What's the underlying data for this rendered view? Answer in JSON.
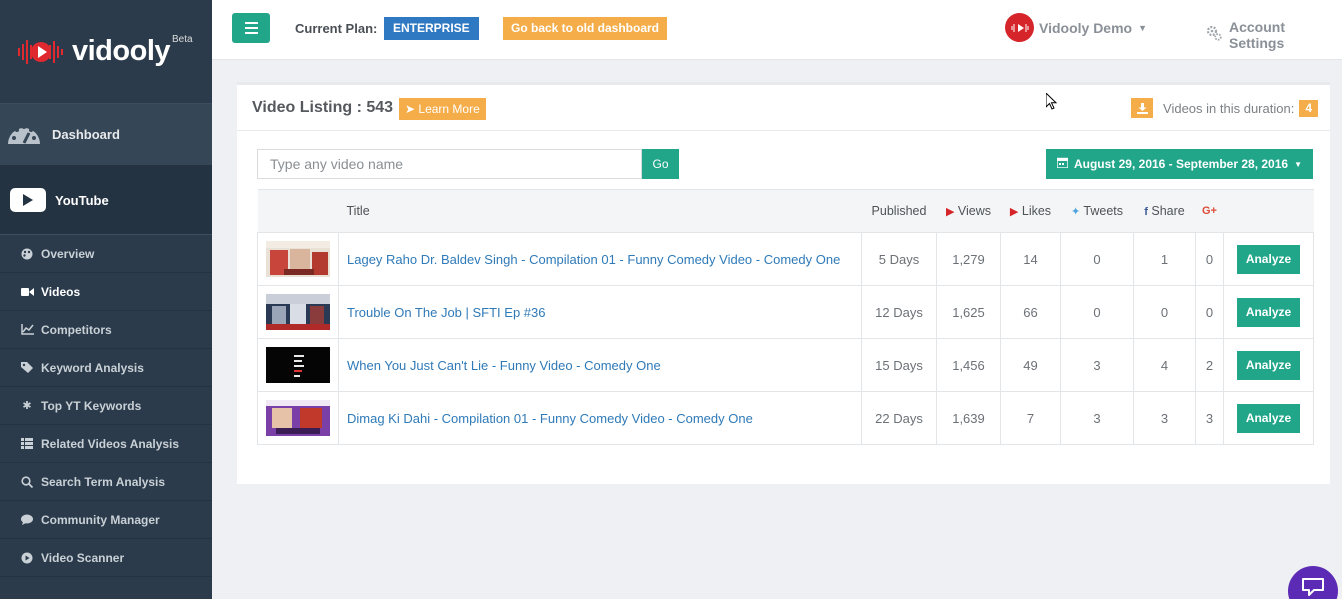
{
  "app": {
    "logo_text": "vidooly",
    "logo_badge": "Beta"
  },
  "sidebar": {
    "dashboard_label": "Dashboard",
    "youtube_label": "YouTube",
    "items": [
      {
        "label": "Overview",
        "icon": "palette-icon"
      },
      {
        "label": "Videos",
        "icon": "video-camera-icon",
        "active": true
      },
      {
        "label": "Competitors",
        "icon": "line-chart-icon"
      },
      {
        "label": "Keyword Analysis",
        "icon": "tags-icon"
      },
      {
        "label": "Top YT Keywords",
        "icon": "asterisk-icon"
      },
      {
        "label": "Related Videos Analysis",
        "icon": "list-icon"
      },
      {
        "label": "Search Term Analysis",
        "icon": "search-icon"
      },
      {
        "label": "Community Manager",
        "icon": "comment-icon"
      },
      {
        "label": "Video Scanner",
        "icon": "play-circle-icon"
      }
    ]
  },
  "topbar": {
    "plan_label": "Current Plan:",
    "plan_value": "ENTERPRISE",
    "old_dashboard_label": "Go back to old dashboard",
    "user_name": "Vidooly Demo",
    "account_label": "Account Settings"
  },
  "listing": {
    "title": "Video Listing : 543",
    "learn_more": "Learn More",
    "duration_label": "Videos in this duration:",
    "duration_count": "4",
    "search_placeholder": "Type any video name",
    "go_label": "Go",
    "date_range": "August 29, 2016 - September 28, 2016"
  },
  "table": {
    "headers": {
      "title": "Title",
      "published": "Published",
      "views": "Views",
      "likes": "Likes",
      "tweets": "Tweets",
      "share": "Share",
      "gplus": "G+"
    },
    "analyze_label": "Analyze",
    "rows": [
      {
        "title": "Lagey Raho Dr. Baldev Singh - Compilation 01 - Funny Comedy Video - Comedy One",
        "published": "5 Days",
        "views": "1,279",
        "likes": "14",
        "tweets": "0",
        "share": "1",
        "gplus": "0"
      },
      {
        "title": "Trouble On The Job | SFTI Ep #36",
        "published": "12 Days",
        "views": "1,625",
        "likes": "66",
        "tweets": "0",
        "share": "0",
        "gplus": "0"
      },
      {
        "title": "When You Just Can't Lie - Funny Video - Comedy One",
        "published": "15 Days",
        "views": "1,456",
        "likes": "49",
        "tweets": "3",
        "share": "4",
        "gplus": "2"
      },
      {
        "title": "Dimag Ki Dahi - Compilation 01 - Funny Comedy Video - Comedy One",
        "published": "22 Days",
        "views": "1,639",
        "likes": "7",
        "tweets": "3",
        "share": "3",
        "gplus": "3"
      }
    ]
  },
  "colors": {
    "sidebar": "#2b3b4b",
    "accent_green": "#21a68a",
    "accent_orange": "#f5ad4a",
    "plan_blue": "#2f79c2",
    "link_blue": "#2f7ab8",
    "chat_purple": "#5c2bb5"
  }
}
